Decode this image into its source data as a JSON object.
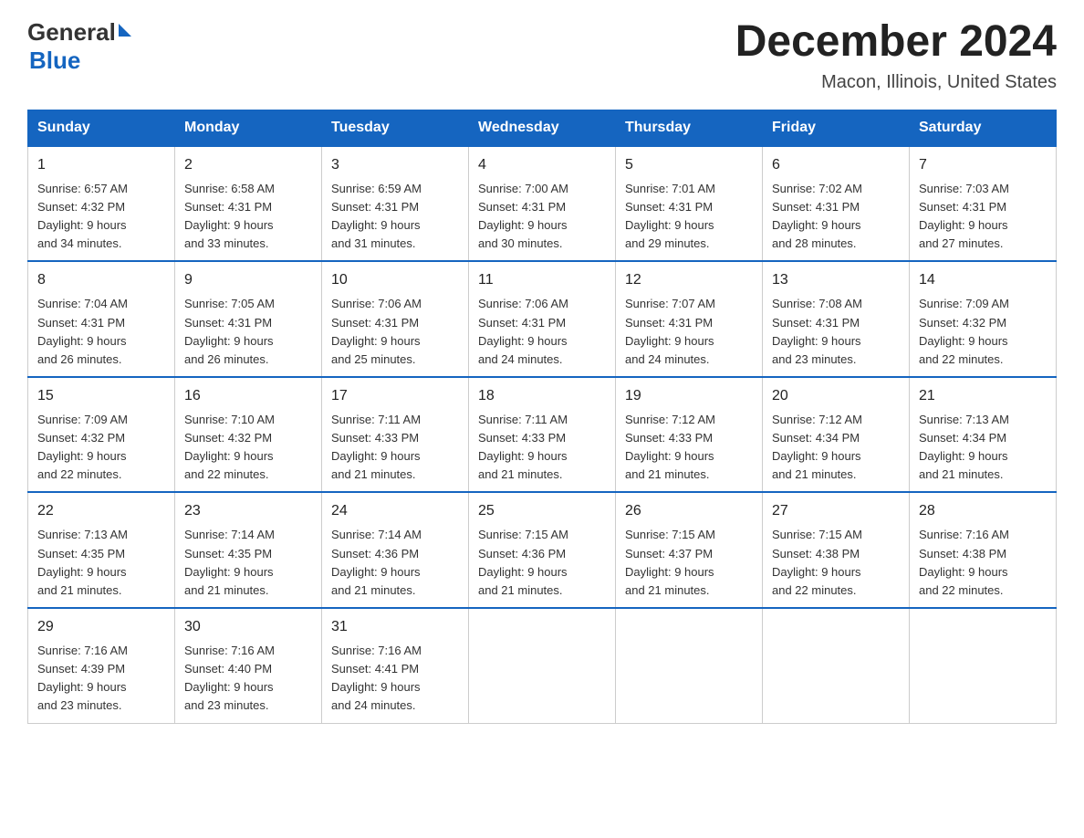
{
  "header": {
    "logo_general": "General",
    "logo_blue": "Blue",
    "month_year": "December 2024",
    "location": "Macon, Illinois, United States"
  },
  "weekdays": [
    "Sunday",
    "Monday",
    "Tuesday",
    "Wednesday",
    "Thursday",
    "Friday",
    "Saturday"
  ],
  "weeks": [
    [
      {
        "day": "1",
        "sunrise": "6:57 AM",
        "sunset": "4:32 PM",
        "daylight": "9 hours and 34 minutes."
      },
      {
        "day": "2",
        "sunrise": "6:58 AM",
        "sunset": "4:31 PM",
        "daylight": "9 hours and 33 minutes."
      },
      {
        "day": "3",
        "sunrise": "6:59 AM",
        "sunset": "4:31 PM",
        "daylight": "9 hours and 31 minutes."
      },
      {
        "day": "4",
        "sunrise": "7:00 AM",
        "sunset": "4:31 PM",
        "daylight": "9 hours and 30 minutes."
      },
      {
        "day": "5",
        "sunrise": "7:01 AM",
        "sunset": "4:31 PM",
        "daylight": "9 hours and 29 minutes."
      },
      {
        "day": "6",
        "sunrise": "7:02 AM",
        "sunset": "4:31 PM",
        "daylight": "9 hours and 28 minutes."
      },
      {
        "day": "7",
        "sunrise": "7:03 AM",
        "sunset": "4:31 PM",
        "daylight": "9 hours and 27 minutes."
      }
    ],
    [
      {
        "day": "8",
        "sunrise": "7:04 AM",
        "sunset": "4:31 PM",
        "daylight": "9 hours and 26 minutes."
      },
      {
        "day": "9",
        "sunrise": "7:05 AM",
        "sunset": "4:31 PM",
        "daylight": "9 hours and 26 minutes."
      },
      {
        "day": "10",
        "sunrise": "7:06 AM",
        "sunset": "4:31 PM",
        "daylight": "9 hours and 25 minutes."
      },
      {
        "day": "11",
        "sunrise": "7:06 AM",
        "sunset": "4:31 PM",
        "daylight": "9 hours and 24 minutes."
      },
      {
        "day": "12",
        "sunrise": "7:07 AM",
        "sunset": "4:31 PM",
        "daylight": "9 hours and 24 minutes."
      },
      {
        "day": "13",
        "sunrise": "7:08 AM",
        "sunset": "4:31 PM",
        "daylight": "9 hours and 23 minutes."
      },
      {
        "day": "14",
        "sunrise": "7:09 AM",
        "sunset": "4:32 PM",
        "daylight": "9 hours and 22 minutes."
      }
    ],
    [
      {
        "day": "15",
        "sunrise": "7:09 AM",
        "sunset": "4:32 PM",
        "daylight": "9 hours and 22 minutes."
      },
      {
        "day": "16",
        "sunrise": "7:10 AM",
        "sunset": "4:32 PM",
        "daylight": "9 hours and 22 minutes."
      },
      {
        "day": "17",
        "sunrise": "7:11 AM",
        "sunset": "4:33 PM",
        "daylight": "9 hours and 21 minutes."
      },
      {
        "day": "18",
        "sunrise": "7:11 AM",
        "sunset": "4:33 PM",
        "daylight": "9 hours and 21 minutes."
      },
      {
        "day": "19",
        "sunrise": "7:12 AM",
        "sunset": "4:33 PM",
        "daylight": "9 hours and 21 minutes."
      },
      {
        "day": "20",
        "sunrise": "7:12 AM",
        "sunset": "4:34 PM",
        "daylight": "9 hours and 21 minutes."
      },
      {
        "day": "21",
        "sunrise": "7:13 AM",
        "sunset": "4:34 PM",
        "daylight": "9 hours and 21 minutes."
      }
    ],
    [
      {
        "day": "22",
        "sunrise": "7:13 AM",
        "sunset": "4:35 PM",
        "daylight": "9 hours and 21 minutes."
      },
      {
        "day": "23",
        "sunrise": "7:14 AM",
        "sunset": "4:35 PM",
        "daylight": "9 hours and 21 minutes."
      },
      {
        "day": "24",
        "sunrise": "7:14 AM",
        "sunset": "4:36 PM",
        "daylight": "9 hours and 21 minutes."
      },
      {
        "day": "25",
        "sunrise": "7:15 AM",
        "sunset": "4:36 PM",
        "daylight": "9 hours and 21 minutes."
      },
      {
        "day": "26",
        "sunrise": "7:15 AM",
        "sunset": "4:37 PM",
        "daylight": "9 hours and 21 minutes."
      },
      {
        "day": "27",
        "sunrise": "7:15 AM",
        "sunset": "4:38 PM",
        "daylight": "9 hours and 22 minutes."
      },
      {
        "day": "28",
        "sunrise": "7:16 AM",
        "sunset": "4:38 PM",
        "daylight": "9 hours and 22 minutes."
      }
    ],
    [
      {
        "day": "29",
        "sunrise": "7:16 AM",
        "sunset": "4:39 PM",
        "daylight": "9 hours and 23 minutes."
      },
      {
        "day": "30",
        "sunrise": "7:16 AM",
        "sunset": "4:40 PM",
        "daylight": "9 hours and 23 minutes."
      },
      {
        "day": "31",
        "sunrise": "7:16 AM",
        "sunset": "4:41 PM",
        "daylight": "9 hours and 24 minutes."
      },
      null,
      null,
      null,
      null
    ]
  ],
  "labels": {
    "sunrise": "Sunrise: ",
    "sunset": "Sunset: ",
    "daylight": "Daylight: "
  }
}
